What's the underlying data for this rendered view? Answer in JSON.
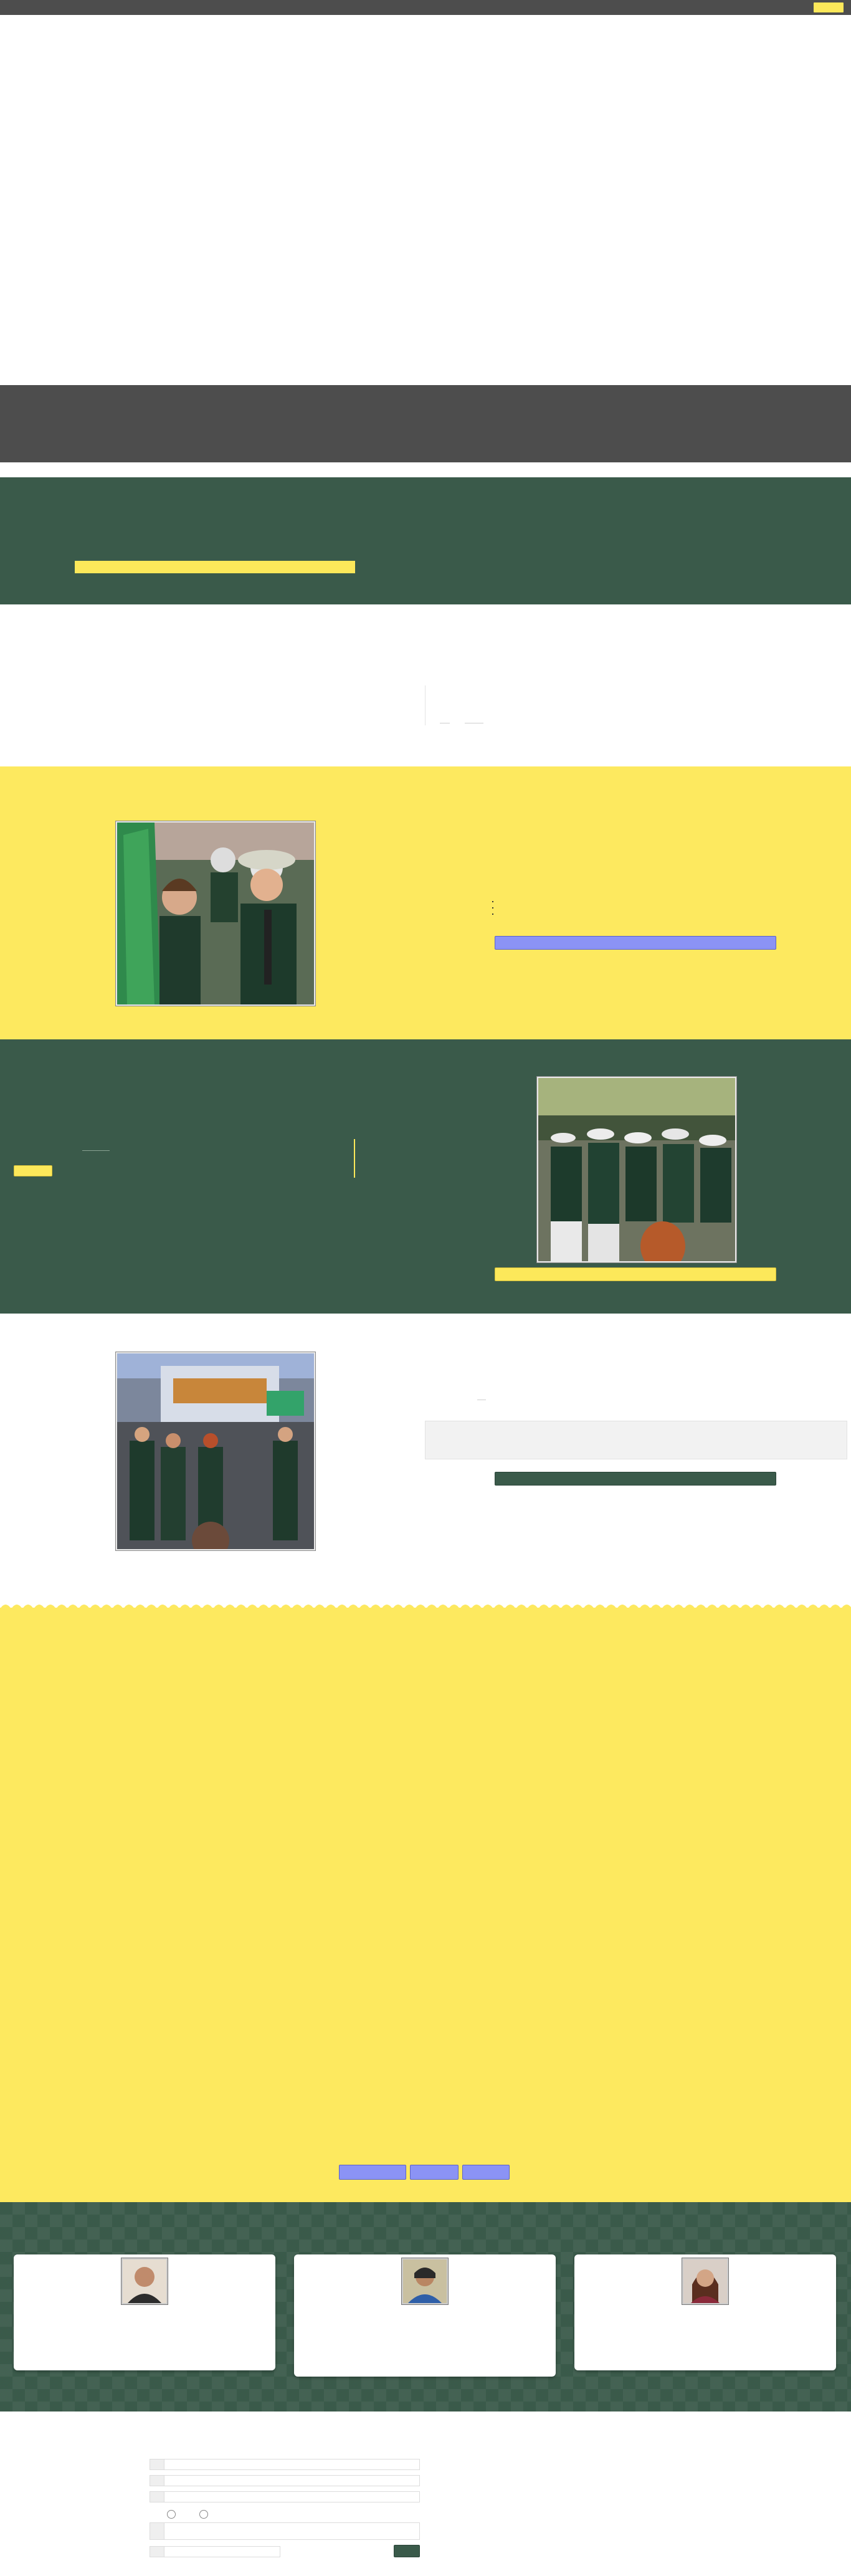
{
  "topbar": {
    "button_label": ""
  },
  "hero": {
    "heading": ""
  },
  "intro": {
    "link_a": "",
    "link_b": ""
  },
  "feature1": {
    "button_label": "",
    "bullets": [
      "",
      "",
      ""
    ]
  },
  "feature2": {
    "button_label": "",
    "side_button_label": ""
  },
  "feature3": {
    "input_placeholder": "",
    "button_label": ""
  },
  "gallery": {
    "pager": [
      "",
      "",
      ""
    ]
  },
  "staff": [
    {
      "name": ""
    },
    {
      "name": ""
    },
    {
      "name": ""
    }
  ],
  "form": {
    "submit_label": ""
  },
  "colors": {
    "green": "#3a5a4a",
    "yellow": "#fde95f",
    "grey": "#4d4d4d",
    "accent_blue": "#8b93f5"
  }
}
